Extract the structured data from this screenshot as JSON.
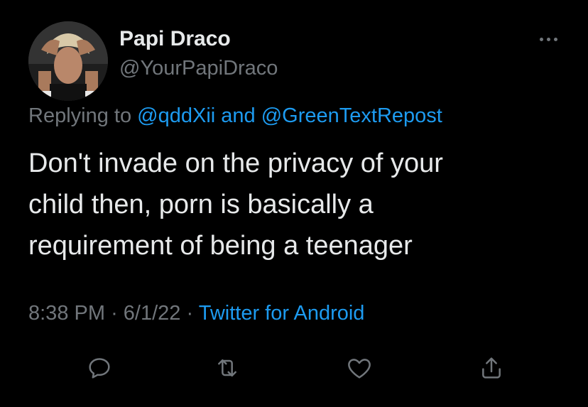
{
  "user": {
    "display_name": "Papi Draco",
    "handle": "@YourPapiDraco",
    "avatar_icon": "profile-photo"
  },
  "reply": {
    "prefix": "Replying to",
    "mention_1": "@qddXii",
    "conjunction": "and",
    "mention_2": "@GreenTextRepost"
  },
  "tweet": {
    "text": "Don't invade on the privacy of your\nchild then, porn is basically a\nrequirement of being a teenager"
  },
  "meta": {
    "time": "8:38 PM",
    "separator": "·",
    "date": "6/1/22",
    "source": "Twitter for Android"
  },
  "actions": {
    "reply_icon": "reply-icon",
    "retweet_icon": "retweet-icon",
    "like_icon": "heart-icon",
    "share_icon": "share-icon",
    "more_icon": "more-icon"
  },
  "colors": {
    "background": "#000000",
    "text": "#e7e9ea",
    "muted": "#71767b",
    "link": "#1d9bf0"
  }
}
